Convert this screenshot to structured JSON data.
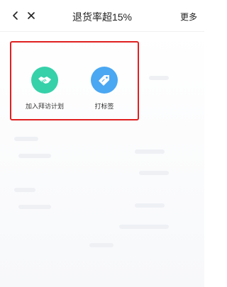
{
  "header": {
    "title": "退货率超15%",
    "more_label": "更多"
  },
  "actions": [
    {
      "label": "加入拜访计划",
      "icon": "handshake-icon",
      "color": "#36d1a9"
    },
    {
      "label": "打标签",
      "icon": "tag-icon",
      "color": "#4aa7f2"
    }
  ],
  "colors": {
    "highlight_border": "#e02020"
  }
}
